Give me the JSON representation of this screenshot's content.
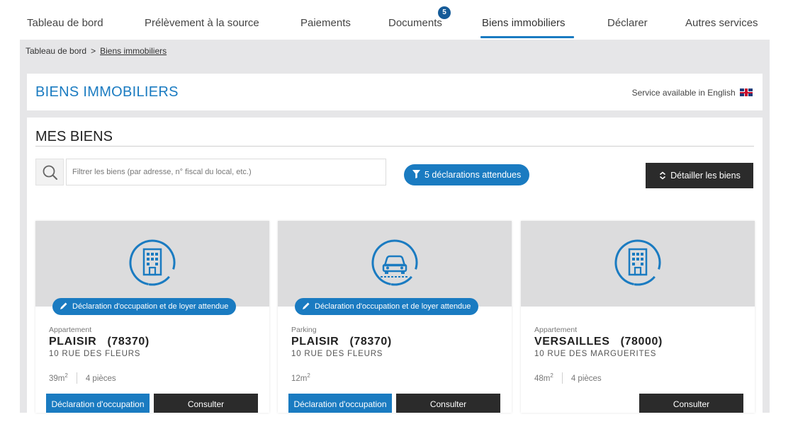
{
  "nav": {
    "items": [
      {
        "label": "Tableau de bord"
      },
      {
        "label": "Prélèvement à la source"
      },
      {
        "label": "Paiements"
      },
      {
        "label": "Documents",
        "badge": "5"
      },
      {
        "label": "Biens immobiliers",
        "active": true
      },
      {
        "label": "Déclarer"
      },
      {
        "label": "Autres services"
      }
    ]
  },
  "breadcrumb": {
    "root": "Tableau de bord",
    "separator": ">",
    "current": "Biens immobiliers"
  },
  "header": {
    "title": "BIENS IMMOBILIERS",
    "english_link": "Service available in English"
  },
  "section": {
    "title": "MES BIENS"
  },
  "search": {
    "placeholder": "Filtrer les biens (par adresse, n° fiscal du local, etc.)",
    "value": ""
  },
  "filter": {
    "label": "5 déclarations attendues",
    "icon": "filter-icon"
  },
  "detail_button": {
    "label": "Détailler les biens",
    "icon": "expand-icon"
  },
  "cards": [
    {
      "icon": "building-icon",
      "status": "Déclaration d'occupation et de loyer attendue",
      "type": "Appartement",
      "city": "PLAISIR   (78370)",
      "address": "10 RUE DES FLEURS",
      "area": "39m",
      "rooms": "4 pièces",
      "declare_label": "Déclaration d'occupation",
      "consult_label": "Consulter"
    },
    {
      "icon": "car-icon",
      "status": "Déclaration d'occupation et de loyer attendue",
      "type": "Parking",
      "city": "PLAISIR   (78370)",
      "address": "10 RUE DES FLEURS",
      "area": "12m",
      "rooms": "",
      "declare_label": "Déclaration d'occupation",
      "consult_label": "Consulter"
    },
    {
      "icon": "building-icon",
      "status": "",
      "type": "Appartement",
      "city": "VERSAILLES   (78000)",
      "address": "10 RUE DES MARGUERITES",
      "area": "48m",
      "rooms": "4 pièces",
      "declare_label": "",
      "consult_label": "Consulter"
    }
  ],
  "colors": {
    "accent": "#1a7bc1",
    "dark_button": "#2b2b2b",
    "page_background": "#e6e6e8",
    "card_media": "#dcdcdd",
    "badge": "#155b98"
  }
}
